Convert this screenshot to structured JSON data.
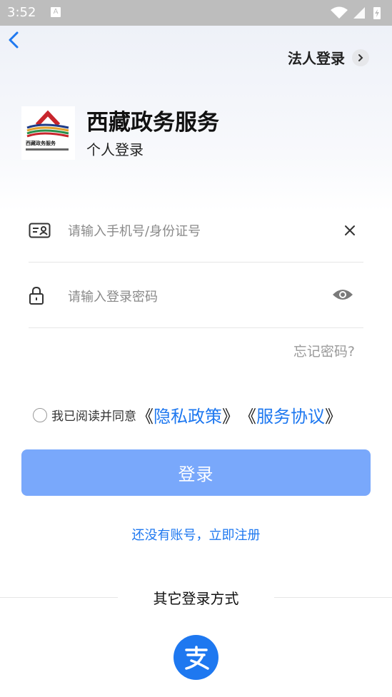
{
  "status_bar": {
    "time": "3:52",
    "notification_icon": "A"
  },
  "header": {
    "legal_login_label": "法人登录"
  },
  "brand": {
    "logo_caption": "西藏政务服务",
    "app_title": "西藏政务服务",
    "login_type": "个人登录"
  },
  "form": {
    "account_placeholder": "请输入手机号/身份证号",
    "password_placeholder": "请输入登录密码",
    "forgot_password": "忘记密码?"
  },
  "agreement": {
    "prefix": "我已阅读并同意",
    "privacy_open": "《",
    "privacy_label": "隐私政策",
    "privacy_close": "》",
    "terms_open": "《",
    "terms_label": "服务协议",
    "terms_close": "》"
  },
  "actions": {
    "login_label": "登录",
    "register_label": "还没有账号，立即注册"
  },
  "other_login": {
    "title": "其它登录方式",
    "alipay_icon": "alipay-icon"
  },
  "colors": {
    "accent": "#1e78f0",
    "login_button": "#79a8fb"
  }
}
